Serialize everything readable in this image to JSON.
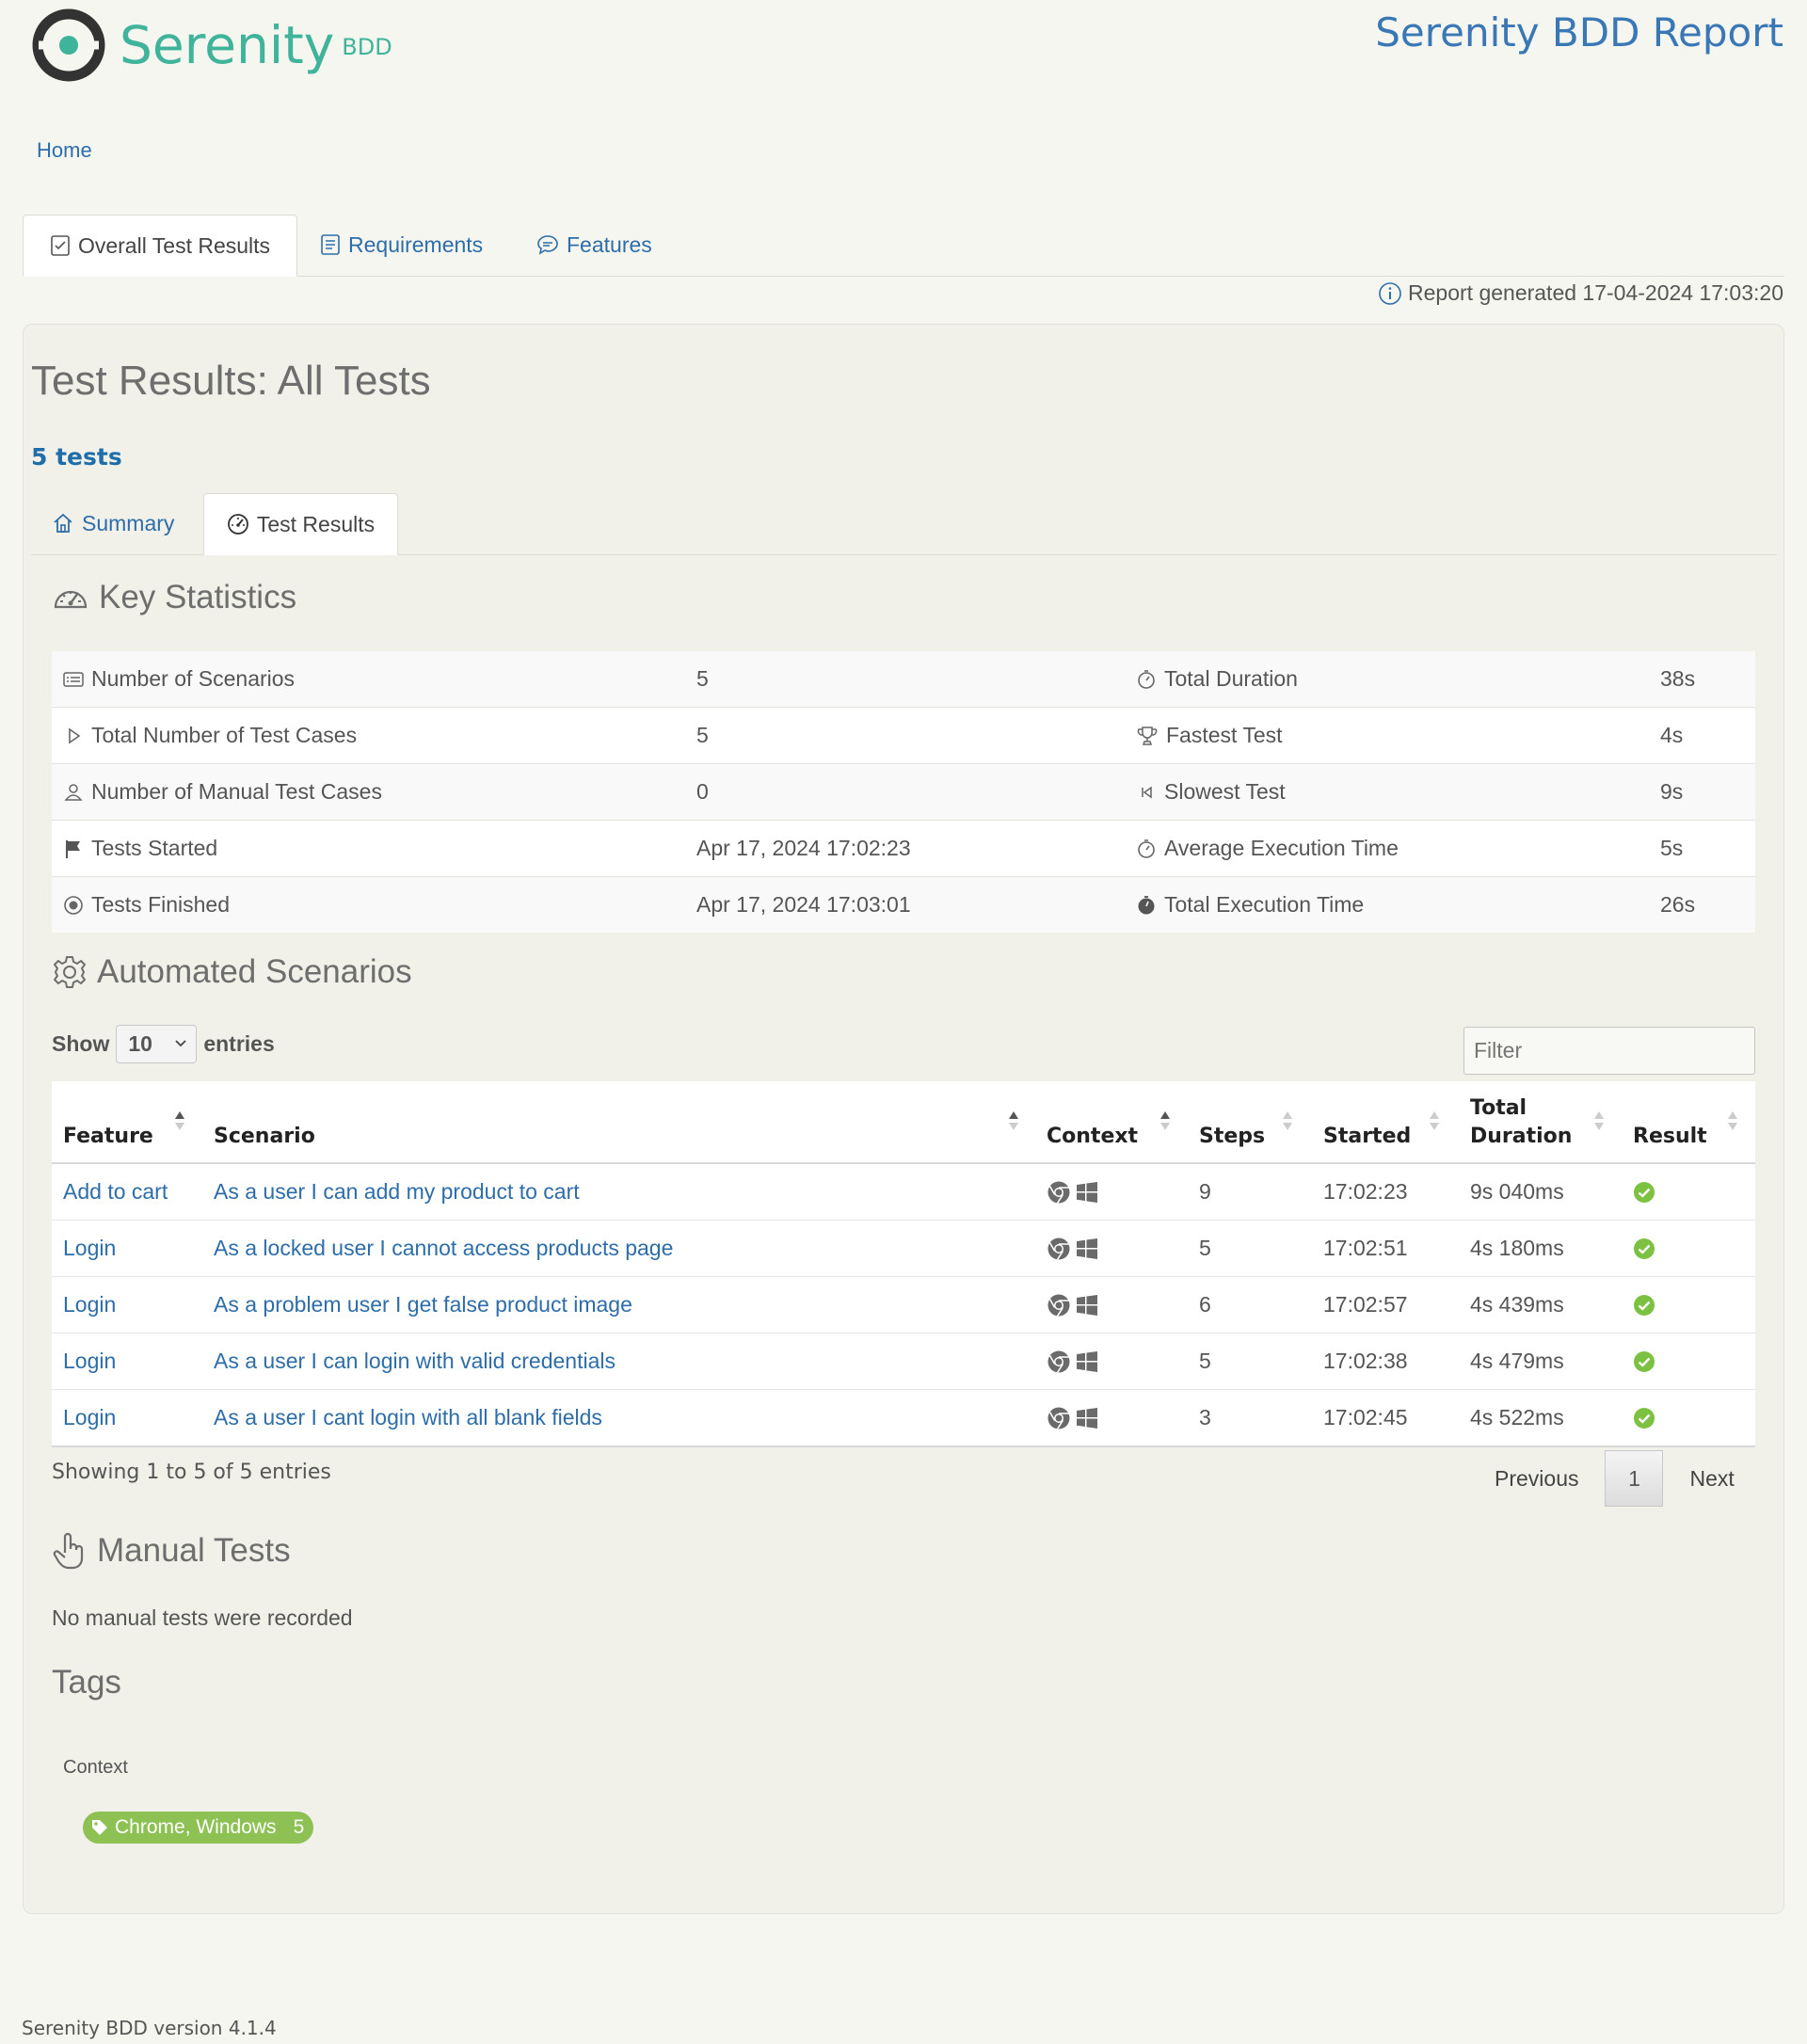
{
  "header": {
    "logo_text": "Serenity",
    "logo_sub": "BDD",
    "report_title": "Serenity BDD Report"
  },
  "breadcrumb": "Home",
  "top_tabs": {
    "overall": "Overall Test Results",
    "requirements": "Requirements",
    "features": "Features"
  },
  "report_generated": "Report generated 17-04-2024 17:03:20",
  "page_title": "Test Results: All Tests",
  "tests_count": "5 tests",
  "inner_tabs": {
    "summary": "Summary",
    "results": "Test Results"
  },
  "key_statistics": {
    "title": "Key Statistics",
    "rows": [
      {
        "label": "Number of Scenarios",
        "icon": "list-icon",
        "value": "5",
        "label2": "Total Duration",
        "icon2": "stopwatch-icon",
        "value2": "38s"
      },
      {
        "label": "Total Number of Test Cases",
        "icon": "play-icon",
        "value": "5",
        "label2": "Fastest Test",
        "icon2": "trophy-icon",
        "value2": "4s"
      },
      {
        "label": "Number of Manual Test Cases",
        "icon": "person-icon",
        "value": "0",
        "label2": "Slowest Test",
        "icon2": "skip-back-icon",
        "value2": "9s"
      },
      {
        "label": "Tests Started",
        "icon": "flag-icon",
        "value": "Apr 17, 2024 17:02:23",
        "label2": "Average Execution Time",
        "icon2": "stopwatch-icon",
        "value2": "5s"
      },
      {
        "label": "Tests Finished",
        "icon": "stop-circle-icon",
        "value": "Apr 17, 2024 17:03:01",
        "label2": "Total Execution Time",
        "icon2": "stopwatch-filled-icon",
        "value2": "26s"
      }
    ]
  },
  "automated": {
    "title": "Automated Scenarios",
    "show_label": "Show",
    "entries_value": "10",
    "entries_label": "entries",
    "filter_placeholder": "Filter",
    "columns": {
      "feature": "Feature",
      "scenario": "Scenario",
      "context": "Context",
      "steps": "Steps",
      "started": "Started",
      "duration_1": "Total",
      "duration_2": "Duration",
      "result": "Result"
    },
    "rows": [
      {
        "feature": "Add to cart",
        "scenario": "As a user I can add my product to cart",
        "steps": "9",
        "started": "17:02:23",
        "duration": "9s 040ms",
        "result": "passed"
      },
      {
        "feature": "Login",
        "scenario": "As a locked user I cannot access products page",
        "steps": "5",
        "started": "17:02:51",
        "duration": "4s 180ms",
        "result": "passed"
      },
      {
        "feature": "Login",
        "scenario": "As a problem user I get false product image",
        "steps": "6",
        "started": "17:02:57",
        "duration": "4s 439ms",
        "result": "passed"
      },
      {
        "feature": "Login",
        "scenario": "As a user I can login with valid credentials",
        "steps": "5",
        "started": "17:02:38",
        "duration": "4s 479ms",
        "result": "passed"
      },
      {
        "feature": "Login",
        "scenario": "As a user I cant login with all blank fields",
        "steps": "3",
        "started": "17:02:45",
        "duration": "4s 522ms",
        "result": "passed"
      }
    ],
    "showing": "Showing 1 to 5 of 5 entries",
    "pager": {
      "previous": "Previous",
      "page": "1",
      "next": "Next"
    }
  },
  "manual": {
    "title": "Manual Tests",
    "message": "No manual tests were recorded"
  },
  "tags": {
    "title": "Tags",
    "context_label": "Context",
    "pill_label": "Chrome, Windows",
    "pill_count": "5"
  },
  "footer": "Serenity BDD version 4.1.4",
  "colors": {
    "accent_green": "#3fb49a",
    "link_blue": "#2d6da9",
    "pass_green": "#7cc142",
    "tag_green": "#8dc154"
  }
}
